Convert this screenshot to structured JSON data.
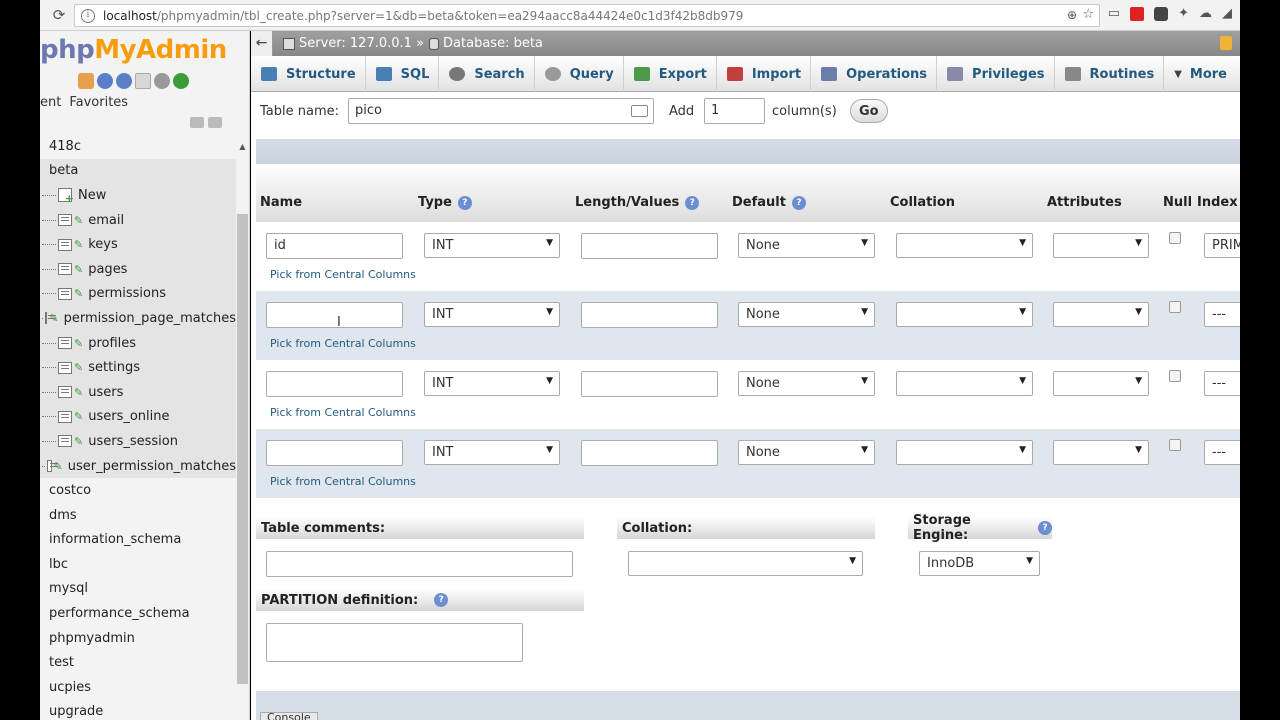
{
  "browser": {
    "url_host": "localhost",
    "url_rest": "/phpmyadmin/tbl_create.php?server=1&db=beta&token=ea294aacc8a44424e0c1d3f42b8db979"
  },
  "sidebar": {
    "logo_php": "php",
    "logo_myadmin": "MyAdmin",
    "tab_recent": "ent",
    "tab_favorites": "Favorites",
    "databases_top": [
      "418c"
    ],
    "open_db": "beta",
    "new_label": "New",
    "tables": [
      "email",
      "keys",
      "pages",
      "permissions",
      "permission_page_matches",
      "profiles",
      "settings",
      "users",
      "users_online",
      "users_session",
      "user_permission_matches"
    ],
    "databases_bottom": [
      "costco",
      "dms",
      "information_schema",
      "lbc",
      "mysql",
      "performance_schema",
      "phpmyadmin",
      "test",
      "ucpies",
      "upgrade"
    ]
  },
  "breadcrumb": {
    "server": "Server: 127.0.0.1 »",
    "database": "Database: beta"
  },
  "menu": [
    {
      "label": "Structure",
      "icon": "structure-icon",
      "color": "#4a7fb5"
    },
    {
      "label": "SQL",
      "icon": "sql-icon",
      "color": "#4a7fb5"
    },
    {
      "label": "Search",
      "icon": "search-icon",
      "color": "#777777"
    },
    {
      "label": "Query",
      "icon": "query-icon",
      "color": "#999999"
    },
    {
      "label": "Export",
      "icon": "export-icon",
      "color": "#4a9a4a"
    },
    {
      "label": "Import",
      "icon": "import-icon",
      "color": "#c04040"
    },
    {
      "label": "Operations",
      "icon": "wrench-icon",
      "color": "#6a7fa8"
    },
    {
      "label": "Privileges",
      "icon": "privileges-icon",
      "color": "#8a8aa8"
    },
    {
      "label": "Routines",
      "icon": "routines-icon",
      "color": "#888888"
    },
    {
      "label": "More",
      "icon": "chevron-down-icon",
      "color": "#444444"
    }
  ],
  "create": {
    "table_name_label": "Table name:",
    "table_name_value": "pico",
    "add_label": "Add",
    "add_value": "1",
    "columns_label": "column(s)",
    "go_label": "Go"
  },
  "headers": {
    "name": "Name",
    "type": "Type",
    "length": "Length/Values",
    "default": "Default",
    "collation": "Collation",
    "attributes": "Attributes",
    "null": "Null",
    "index": "Index"
  },
  "rows": [
    {
      "name": "id",
      "type": "INT",
      "length": "",
      "default": "None",
      "collation": "",
      "attributes": "",
      "index": "PRIMARY"
    },
    {
      "name": "",
      "type": "INT",
      "length": "",
      "default": "None",
      "collation": "",
      "attributes": "",
      "index": "---"
    },
    {
      "name": "",
      "type": "INT",
      "length": "",
      "default": "None",
      "collation": "",
      "attributes": "",
      "index": "---"
    },
    {
      "name": "",
      "type": "INT",
      "length": "",
      "default": "None",
      "collation": "",
      "attributes": "",
      "index": "---"
    }
  ],
  "pick_label": "Pick from Central Columns",
  "bottom": {
    "table_comments": "Table comments:",
    "collation": "Collation:",
    "storage_engine": "Storage Engine:",
    "storage_value": "InnoDB",
    "partition": "PARTITION definition:",
    "console": "Console"
  }
}
